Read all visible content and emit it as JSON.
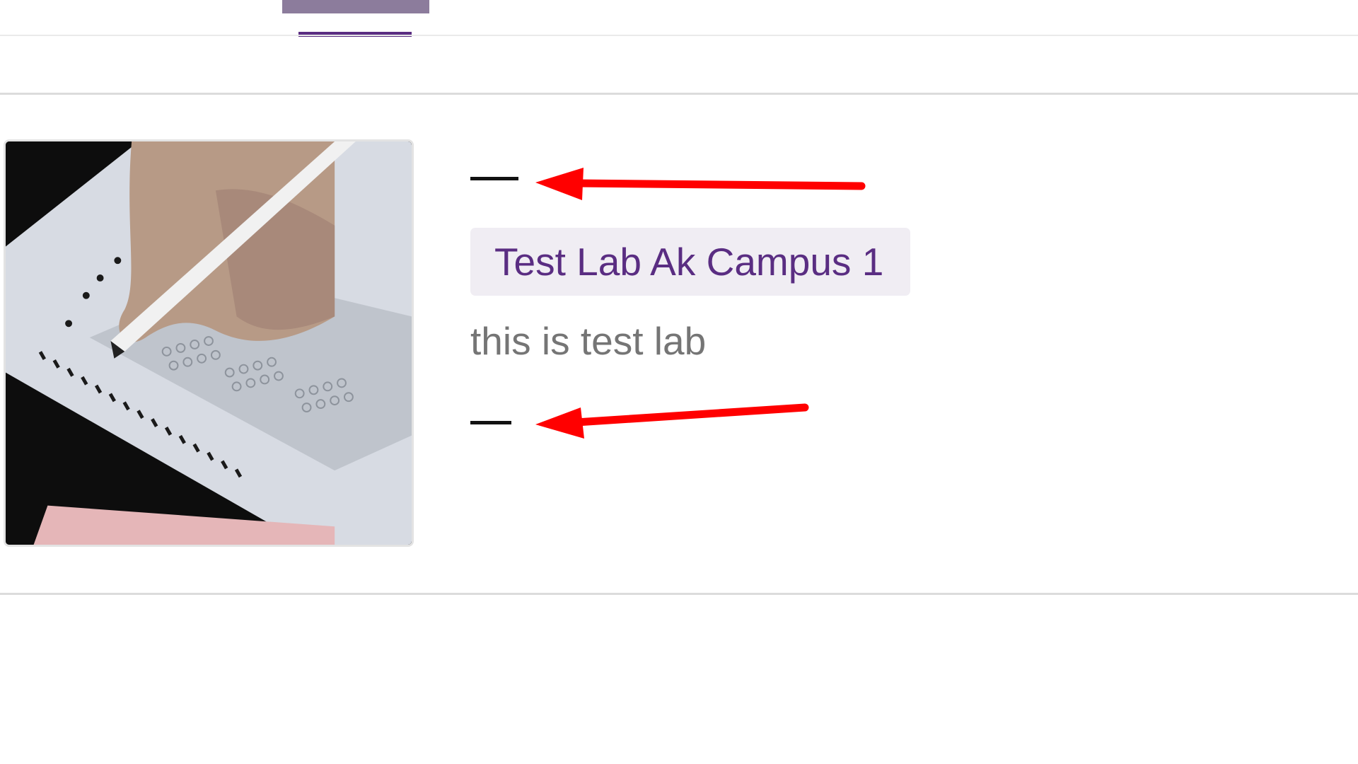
{
  "card": {
    "title_label": "Test Lab Ak Campus 1",
    "description": "this is test lab",
    "top_value": "",
    "bottom_value": "",
    "image_subject": "answer-sheet-with-pencil-photo"
  },
  "colors": {
    "accent": "#5a2d82",
    "tab_inactive": "#8c7c9c",
    "tag_background": "#f0edf3",
    "description_text": "#757575",
    "annotation_arrow": "#ff0000"
  },
  "annotations": [
    {
      "type": "arrow",
      "color": "#ff0000",
      "points_to": "top-dash"
    },
    {
      "type": "arrow",
      "color": "#ff0000",
      "points_to": "bottom-dash"
    }
  ]
}
